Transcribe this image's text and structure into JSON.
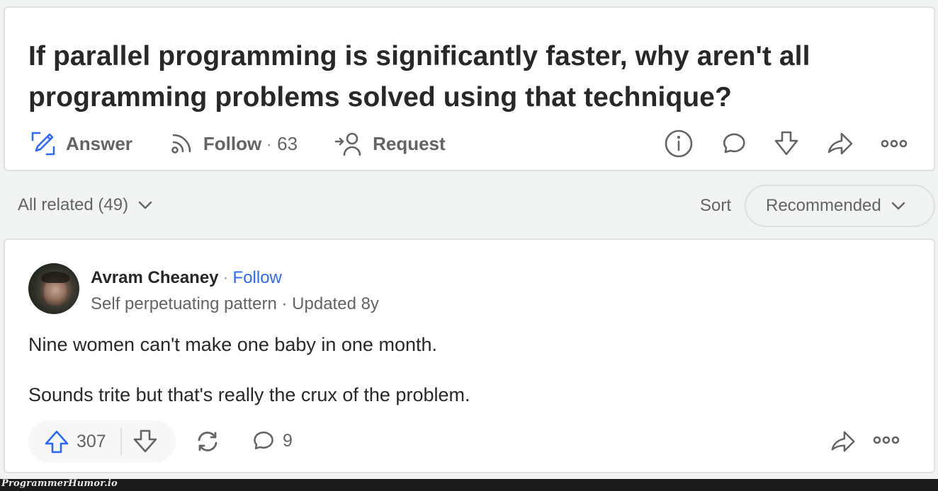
{
  "question": {
    "title": "If parallel programming is significantly faster, why aren't all programming problems solved using that technique?",
    "actions": {
      "answer_label": "Answer",
      "follow_label": "Follow",
      "follow_separator": "·",
      "follow_count": "63",
      "request_label": "Request"
    },
    "icons": [
      "info-icon",
      "comment-icon",
      "downvote-icon",
      "share-icon",
      "more-icon"
    ]
  },
  "filter": {
    "related_label": "All related (49)",
    "sort_label": "Sort",
    "sort_value": "Recommended"
  },
  "answer": {
    "author_name": "Avram Cheaney",
    "separator": "·",
    "follow_label": "Follow",
    "credential": "Self perpetuating pattern · Updated 8y",
    "paragraphs": [
      "Nine women can't make one baby in one month.",
      "Sounds trite but that's really the crux of the problem."
    ],
    "upvotes": "307",
    "comments": "9"
  },
  "colors": {
    "accent_blue": "#2e69ff",
    "text_primary": "#282829",
    "text_secondary": "#636466",
    "page_bg": "#f1f2f2"
  },
  "watermark": "ProgrammerHumor.io"
}
